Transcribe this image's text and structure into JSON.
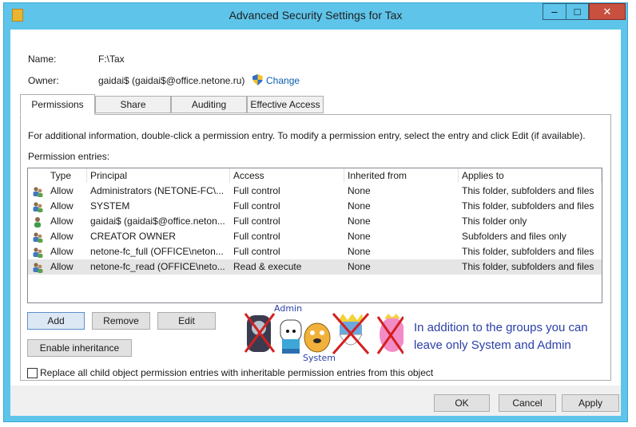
{
  "window": {
    "title": "Advanced Security Settings for Tax",
    "min_symbol": "–",
    "max_symbol": "□",
    "close_symbol": "✕"
  },
  "colors": {
    "frame": "#5ec4ea",
    "close": "#c7503f",
    "link": "#0b5fb0",
    "annotation": "#2a3fa8",
    "cross": "#d42020"
  },
  "info": {
    "name_label": "Name:",
    "name_value": "F:\\Tax",
    "owner_label": "Owner:",
    "owner_value": "gaidai$ (gaidai$@office.netone.ru)",
    "change_link": "Change"
  },
  "tabs": [
    {
      "label": "Permissions",
      "active": true
    },
    {
      "label": "Share",
      "active": false
    },
    {
      "label": "Auditing",
      "active": false
    },
    {
      "label": "Effective Access",
      "active": false
    }
  ],
  "panel": {
    "description": "For additional information, double-click a permission entry. To modify a permission entry, select the entry and click Edit (if available).",
    "entries_label": "Permission entries:"
  },
  "table": {
    "columns": [
      "Type",
      "Principal",
      "Access",
      "Inherited from",
      "Applies to"
    ],
    "rows": [
      {
        "icon": "group-icon",
        "type": "Allow",
        "principal": "Administrators (NETONE-FC\\...",
        "access": "Full control",
        "inherited": "None",
        "applies": "This folder, subfolders and files"
      },
      {
        "icon": "group-icon",
        "type": "Allow",
        "principal": "SYSTEM",
        "access": "Full control",
        "inherited": "None",
        "applies": "This folder, subfolders and files"
      },
      {
        "icon": "user-icon",
        "type": "Allow",
        "principal": "gaidai$ (gaidai$@office.neton...",
        "access": "Full control",
        "inherited": "None",
        "applies": "This folder only"
      },
      {
        "icon": "group-icon",
        "type": "Allow",
        "principal": "CREATOR OWNER",
        "access": "Full control",
        "inherited": "None",
        "applies": "Subfolders and files only"
      },
      {
        "icon": "group-icon",
        "type": "Allow",
        "principal": "netone-fc_full (OFFICE\\neton...",
        "access": "Full control",
        "inherited": "None",
        "applies": "This folder, subfolders and files"
      },
      {
        "icon": "group-icon",
        "type": "Allow",
        "principal": "netone-fc_read (OFFICE\\neto...",
        "access": "Read & execute",
        "inherited": "None",
        "applies": "This folder, subfolders and files",
        "selected": true
      }
    ]
  },
  "buttons": {
    "add": "Add",
    "remove": "Remove",
    "edit": "Edit",
    "enable_inheritance": "Enable inheritance",
    "ok": "OK",
    "cancel": "Cancel",
    "apply": "Apply"
  },
  "replace_checkbox": {
    "label": "Replace all child object permission entries with inheritable permission entries from this object",
    "checked": false
  },
  "annotation": {
    "label_admin": "Admin",
    "label_system": "System",
    "note": "In addition to the groups you can leave only System and Admin",
    "characters": [
      {
        "name": "marceline-character",
        "color": "#3b3b4f",
        "crossed": true
      },
      {
        "name": "finn-character",
        "color": "#ffffff",
        "crossed": false
      },
      {
        "name": "jake-character",
        "color": "#f1b13a",
        "crossed": false
      },
      {
        "name": "ice-king-character",
        "color": "#6aa9e0",
        "crossed": true
      },
      {
        "name": "princess-bubblegum-character",
        "color": "#f28cc7",
        "crossed": true
      }
    ]
  }
}
